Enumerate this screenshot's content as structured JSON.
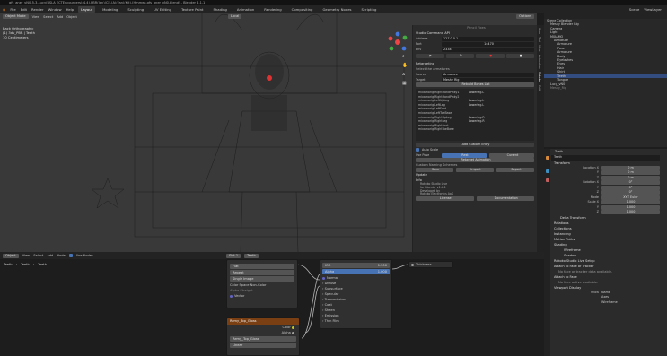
{
  "window": {
    "title": "gfs_aner_vN0-5-3-Lucy(BSLA ECTEncounters)(4.4).PBR(Jan)(Cl).(A)(Fan)(Kit).(Hmmw).gfs_aner_vN0.blend) - Blender 4.1.1"
  },
  "menu": [
    "File",
    "Edit",
    "Render",
    "Window",
    "Help"
  ],
  "workspaces": [
    "Layout",
    "Modeling",
    "Sculpting",
    "UV Editing",
    "Texture Paint",
    "Shading",
    "Animation",
    "Rendering",
    "Compositing",
    "Geometry Nodes",
    "Scripting"
  ],
  "active_workspace": "Layout",
  "top_right": {
    "scene": "Scene",
    "view_layer": "ViewLayer"
  },
  "viewport": {
    "mode": "Object Mode",
    "menus": [
      "View",
      "Select",
      "Add",
      "Object"
    ],
    "transform": "Local",
    "overlay": [
      "Back Orthographic",
      "(1) 3dv_PBR | Teeth",
      "10 Centimeters"
    ],
    "options": "Options"
  },
  "npanel": {
    "header": "Pencil Fixes",
    "studio": {
      "title": "Studio Command API",
      "address_label": "Address",
      "address": "127.0.0.1",
      "port_label": "Port",
      "port": "14470",
      "env_label": "Env",
      "env": "2334"
    },
    "retargeting": {
      "title": "Retargeting",
      "select_label": "Select the armatures",
      "source_label": "Source",
      "source": "Armature",
      "target_label": "Target",
      "target": "Meshy Rig",
      "rebuild": "Rebuild Bones List"
    },
    "bones": [
      [
        "mixamorig:RightHandPinky1",
        "Lowerleg.L"
      ],
      [
        "mixamorig:RightHandPinky2",
        ""
      ],
      [
        "mixamorig:LeftUpLeg",
        "Lowerleg.L"
      ],
      [
        "mixamorig:LeftLeg",
        "Lowerleg.L"
      ],
      [
        "mixamorig:LeftFoot",
        ""
      ],
      [
        "mixamorig:LeftToeBase",
        ""
      ],
      [
        "mixamorig:RightUpLeg",
        "Lowerleg.R"
      ],
      [
        "mixamorig:RightLeg",
        "Lowerleg.R"
      ],
      [
        "mixamorig:RightFoot",
        ""
      ],
      [
        "mixamorig:RightToeBase",
        ""
      ]
    ],
    "add_custom": "Add Custom Entry",
    "auto_scale": "Auto Scale",
    "use_pose_label": "Use Pose",
    "pose_opts": [
      "Rest",
      "Current"
    ],
    "retarget_btn": "Retarget Animation",
    "custom_naming": "Custom Naming Schemes",
    "naming_opts": [
      "Save",
      "Import",
      "Export"
    ],
    "update": "Update",
    "info_title": "Info",
    "info_lines": [
      "Rokoko Studio Live",
      "for Blender v1.4.1",
      "Developed by",
      "Rokoko Electronics ApS"
    ],
    "links": [
      "License",
      "Documentation"
    ]
  },
  "ntabs": [
    "Item",
    "Tool",
    "View",
    "Animation",
    "Rokoko",
    "Edit"
  ],
  "outliner": {
    "title": "Scene Collection",
    "items": [
      "Scene Collection",
      "Meshy Blender Rig",
      "Camera",
      "Light",
      "MIXAMO",
      "Armature",
      "Armature",
      "Pose",
      "Armature",
      "Body",
      "Eyelashes",
      "Eyes",
      "Hair",
      "Shirt",
      "Teeth",
      "Tongue",
      "Lucy_vN0",
      "Meshy_Rig"
    ]
  },
  "properties": {
    "object": "Teeth",
    "transform": "Transform",
    "location_label": "Location X",
    "loc": [
      "0 m",
      "0 m",
      "0 m"
    ],
    "rotation_label": "Rotation X",
    "rot": [
      "0°",
      "0°",
      "0°"
    ],
    "mode_label": "Mode",
    "mode": "XYZ Euler",
    "scale_label": "Scale X",
    "scale": [
      "1.000",
      "1.000",
      "1.000"
    ],
    "delta": "Delta Transform",
    "sections": [
      "Relations",
      "Collections",
      "Instancing",
      "Motion Paths",
      "Visibility",
      "Viewport Display",
      "Line Art",
      "Custom Properties"
    ],
    "shading": "Shading",
    "shading_opts": [
      "Wireframe",
      "Shadow"
    ],
    "rokoko": "Rokoko Studio Live Setup",
    "attach": "Attach to Face or Tracker",
    "no_face": "No face or tracker data available.",
    "attach_face": "Attach to Face",
    "no_face_active": "No face active available.",
    "vp_display": "Viewport Display",
    "show_label": "Show",
    "show_opts": [
      "Name",
      "Axes",
      "Wireframe"
    ]
  },
  "node_editor": {
    "mode": "Object",
    "menus": [
      "View",
      "Select",
      "Add",
      "Node"
    ],
    "use_nodes": "Use Nodes",
    "slot": "Slot 1",
    "material": "Teeth",
    "breadcrumb": [
      "Teeth",
      "Teeth",
      "Teeth"
    ],
    "tex_node": {
      "interp": "Flat",
      "ext": "Repeat",
      "src": "Single Image",
      "cs_label": "Color Space",
      "cs": "Non-Color",
      "alpha_label": "Alpha",
      "alpha": "Straight",
      "vector": "Vector"
    },
    "bsdf": {
      "ior_label": "IOR",
      "ior": "1.500",
      "alpha_label": "Alpha",
      "alpha": "1.000",
      "rows": [
        "Normal",
        "Diffuse",
        "Subsurface",
        "Specular",
        "Transmission",
        "Coat",
        "Sheen",
        "Emission",
        "Thin Film"
      ]
    },
    "out": "Thickness",
    "tex2": {
      "title": "Remy_Top_Gloss",
      "color": "Color",
      "alpha": "Alpha",
      "image": "Remy_Top_Gloss",
      "mode": "Linear"
    }
  }
}
